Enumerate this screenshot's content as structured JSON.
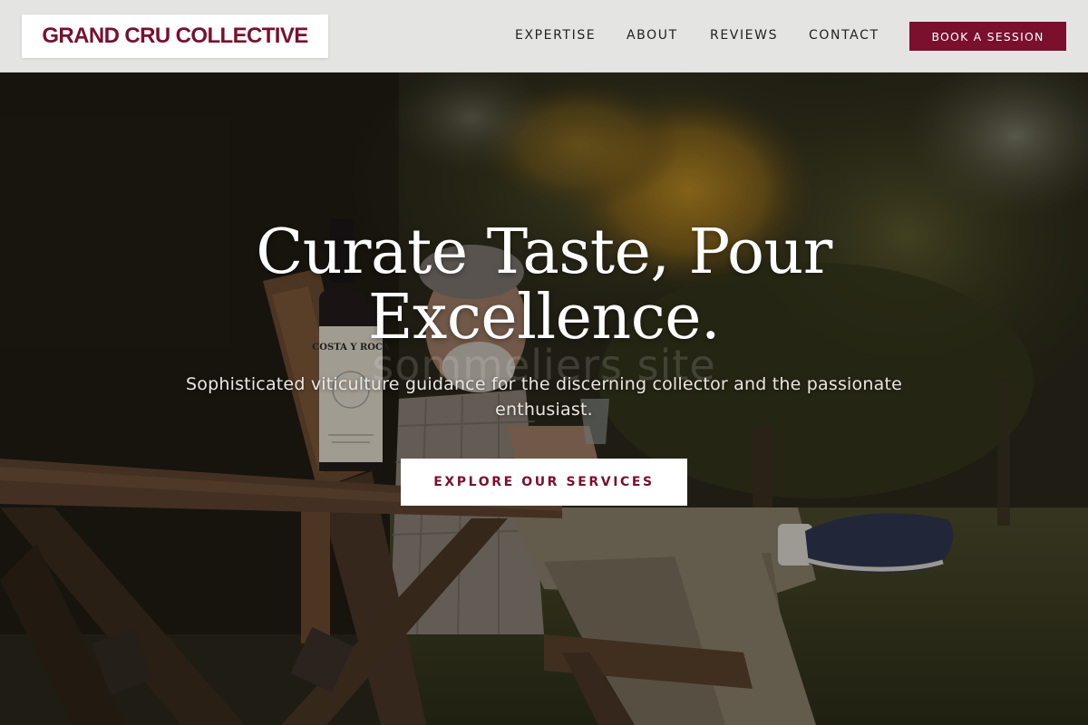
{
  "brand": {
    "name": "GRAND CRU COLLECTIVE",
    "accent_color": "#7a0f2e"
  },
  "nav": {
    "items": [
      {
        "label": "EXPERTISE"
      },
      {
        "label": "ABOUT"
      },
      {
        "label": "REVIEWS"
      },
      {
        "label": "CONTACT"
      }
    ],
    "cta_label": "BOOK A SESSION"
  },
  "hero": {
    "headline_line1": "Curate Taste, Pour",
    "headline_line2": "Excellence.",
    "subheading": "Sophisticated viticulture guidance for the discerning collector and the passionate enthusiast.",
    "watermark": "sommeliers site",
    "cta_label": "EXPLORE OUR SERVICES",
    "bottle_label": "COSTA Y ROCA"
  }
}
